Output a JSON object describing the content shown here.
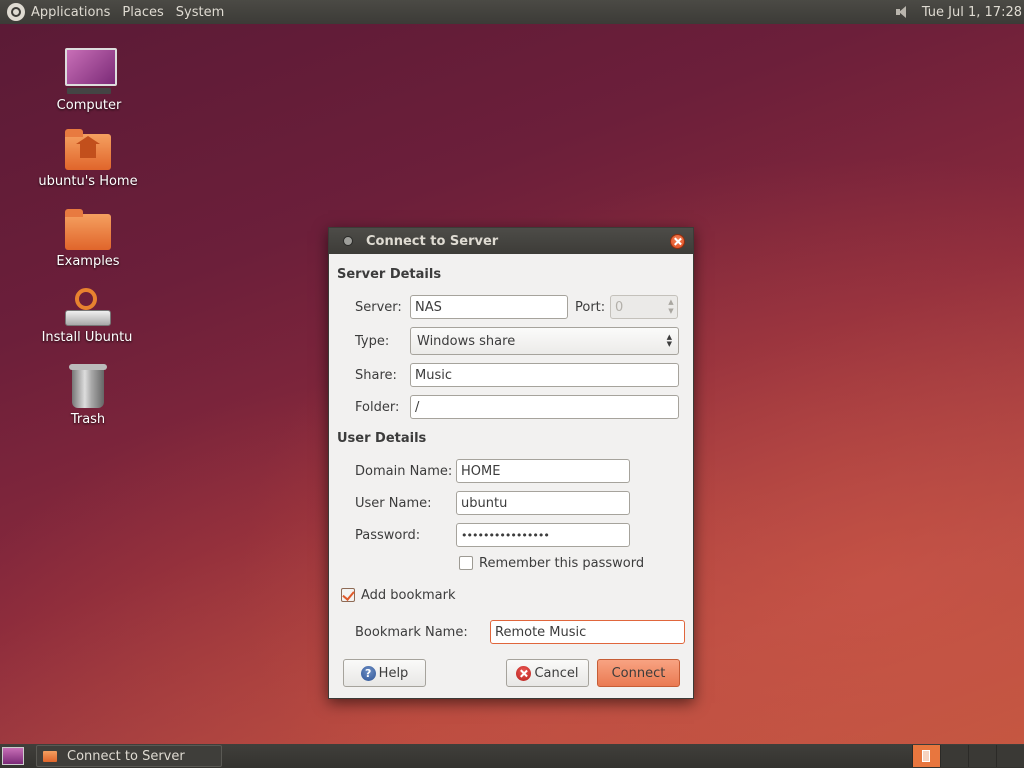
{
  "top_panel": {
    "menus": [
      "Applications",
      "Places",
      "System"
    ],
    "clock": "Tue Jul  1, 17:28"
  },
  "desktop_icons": [
    {
      "label": "Computer",
      "icon": "computer-icon"
    },
    {
      "label": "ubuntu's Home",
      "icon": "home-folder-icon"
    },
    {
      "label": "Examples",
      "icon": "folder-icon"
    },
    {
      "label": "Install Ubuntu",
      "icon": "installer-icon"
    },
    {
      "label": "Trash",
      "icon": "trash-icon"
    }
  ],
  "dialog": {
    "title": "Connect to Server",
    "server_details_heading": "Server Details",
    "server_label": "Server:",
    "server_value": "NAS",
    "port_label": "Port:",
    "port_value": "0",
    "type_label": "Type:",
    "type_value": "Windows share",
    "share_label": "Share:",
    "share_value": "Music",
    "folder_label": "Folder:",
    "folder_value": "/",
    "user_details_heading": "User Details",
    "domain_label": "Domain Name:",
    "domain_value": "HOME",
    "username_label": "User Name:",
    "username_value": "ubuntu",
    "password_label": "Password:",
    "password_value": "••••••••••••••••",
    "remember_label": "Remember this password",
    "remember_checked": false,
    "bookmark_label": "Add bookmark",
    "bookmark_checked": true,
    "bookmark_name_label": "Bookmark Name:",
    "bookmark_name_value": "Remote Music",
    "help_button": "Help",
    "cancel_button": "Cancel",
    "connect_button": "Connect"
  },
  "bottom_panel": {
    "task": "Connect to Server"
  },
  "colors": {
    "accent": "#e0663c",
    "panel": "#3c3b37"
  }
}
